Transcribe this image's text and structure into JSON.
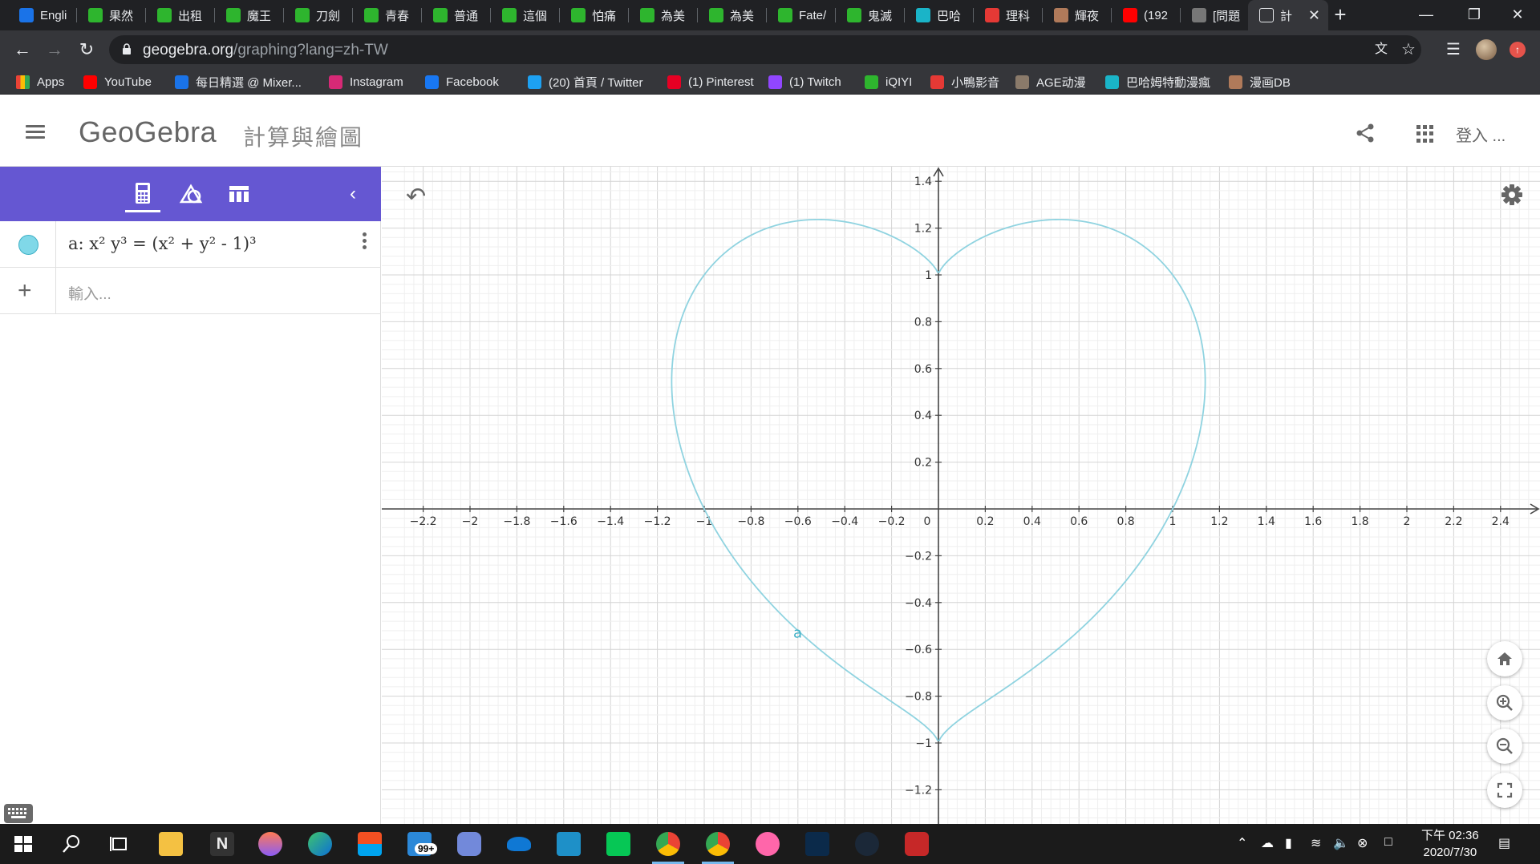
{
  "browser": {
    "tabs": [
      {
        "title": "Engli",
        "color": "#1a73e8"
      },
      {
        "title": "果然",
        "color": "#2eb52e"
      },
      {
        "title": "出租",
        "color": "#2eb52e"
      },
      {
        "title": "魔王",
        "color": "#2eb52e"
      },
      {
        "title": "刀劍",
        "color": "#2eb52e"
      },
      {
        "title": "青春",
        "color": "#2eb52e"
      },
      {
        "title": "普通",
        "color": "#2eb52e"
      },
      {
        "title": "這個",
        "color": "#2eb52e"
      },
      {
        "title": "怕痛",
        "color": "#2eb52e"
      },
      {
        "title": "為美",
        "color": "#2eb52e"
      },
      {
        "title": "為美",
        "color": "#2eb52e"
      },
      {
        "title": "Fate/",
        "color": "#2eb52e"
      },
      {
        "title": "鬼滅",
        "color": "#2eb52e"
      },
      {
        "title": "巴哈",
        "color": "#1ab4c8"
      },
      {
        "title": "理科",
        "color": "#e53935"
      },
      {
        "title": "輝夜",
        "color": "#b07a5a"
      },
      {
        "title": "(192",
        "color": "#ff0000"
      },
      {
        "title": "[問題",
        "color": "#777777"
      },
      {
        "title": "計",
        "color": "#202124",
        "active": true
      }
    ],
    "url_host": "geogebra.org",
    "url_path": "/graphing?lang=zh-TW",
    "bookmarks": [
      {
        "label": "Apps",
        "color": "#e8453c"
      },
      {
        "label": "YouTube",
        "color": "#ff0000"
      },
      {
        "label": "每日精選 @ Mixer...",
        "color": "#1a73e8"
      },
      {
        "label": "Instagram",
        "color": "#d62976"
      },
      {
        "label": "Facebook",
        "color": "#1877f2"
      },
      {
        "label": "(20) 首頁 / Twitter",
        "color": "#1da1f2"
      },
      {
        "label": "(1) Pinterest",
        "color": "#e60023"
      },
      {
        "label": "(1) Twitch",
        "color": "#9146ff"
      },
      {
        "label": "iQIYI",
        "color": "#2eb52e"
      },
      {
        "label": "小鴨影音",
        "color": "#e53935"
      },
      {
        "label": "AGE动漫",
        "color": "#8a7a6a"
      },
      {
        "label": "巴哈姆特動漫瘋",
        "color": "#1ab4c8"
      },
      {
        "label": "漫画DB",
        "color": "#b07a5a"
      }
    ]
  },
  "app": {
    "logo": "GeoGebra",
    "title": "計算與繪圖",
    "login": "登入 ...",
    "accent": "#6557d2"
  },
  "algebra": {
    "expression": "a: x² y³ = (x² + y² - 1)³",
    "input_placeholder": "輸入..."
  },
  "chart_data": {
    "type": "line",
    "title": "",
    "xlabel": "",
    "ylabel": "",
    "xlim": [
      -2.3,
      2.55
    ],
    "ylim": [
      -1.35,
      1.45
    ],
    "grid": true,
    "x_ticks": [
      "−2.2",
      "−2",
      "−1.8",
      "−1.6",
      "−1.4",
      "−1.2",
      "−1",
      "−0.8",
      "−0.6",
      "−0.4",
      "−0.2",
      "0",
      "0.2",
      "0.4",
      "0.6",
      "0.8",
      "1",
      "1.2",
      "1.4",
      "1.6",
      "1.8",
      "2",
      "2.2",
      "2.4"
    ],
    "y_ticks": [
      "1.4",
      "1.2",
      "1",
      "0.8",
      "0.6",
      "0.4",
      "0.2",
      "−0.2",
      "−0.4",
      "−0.6",
      "−0.8",
      "−1",
      "−1.2"
    ],
    "series": [
      {
        "name": "a",
        "equation": "x² y³ = (x² + y² - 1)³",
        "color": "#8fd3e0"
      }
    ],
    "curve_label": "a"
  },
  "taskbar": {
    "time": "下午 02:36",
    "date": "2020/7/30",
    "mail_badge": "99+"
  }
}
